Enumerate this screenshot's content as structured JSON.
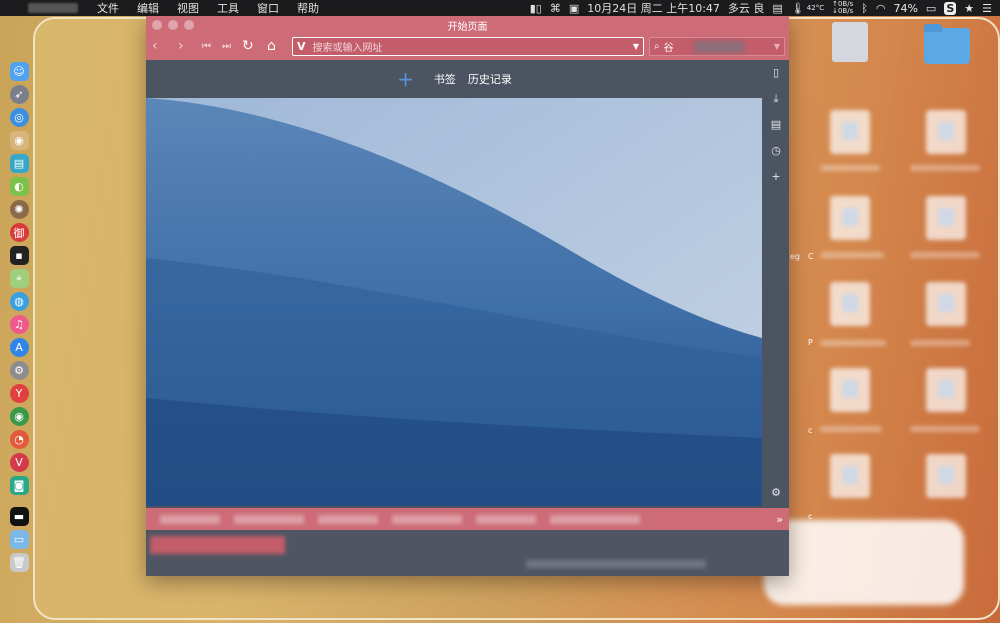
{
  "menubar": {
    "items": [
      "文件",
      "编辑",
      "视图",
      "工具",
      "窗口",
      "帮助"
    ],
    "datetime": "10月24日 周二 上午10:47",
    "weather": "多云 良",
    "temperature": "42°C",
    "net_up": "↑0B/s",
    "net_down": "↓0B/s",
    "battery": "74%"
  },
  "browser": {
    "title": "开始页面",
    "address_placeholder": "搜索或输入网址",
    "search_placeholder": "谷",
    "start_bar": {
      "add_label": "+",
      "bookmarks_label": "书签",
      "history_label": "历史记录"
    }
  },
  "desktop": {
    "edge_labels": [
      "eg",
      "C",
      "P",
      "c",
      "c"
    ]
  },
  "colors": {
    "theme": "#cd6b77",
    "panel": "#4c5461",
    "accent": "#5a94d8"
  }
}
